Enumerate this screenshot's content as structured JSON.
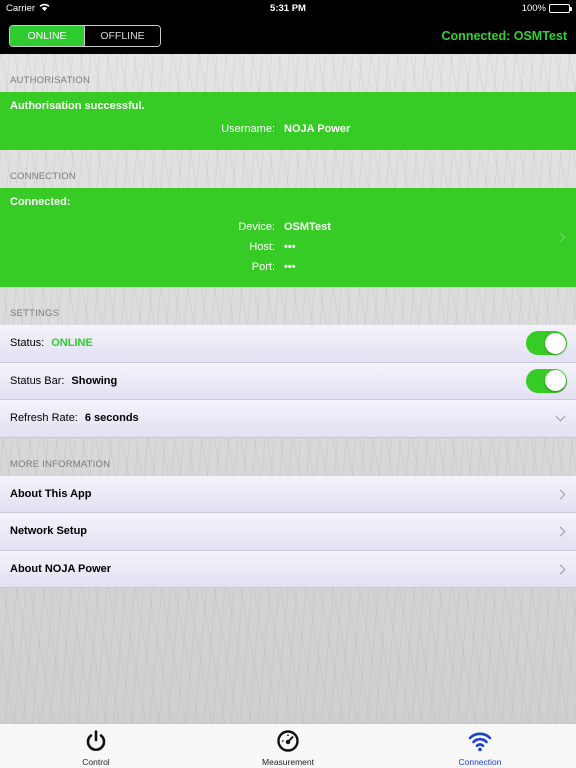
{
  "status_bar": {
    "carrier": "Carrier",
    "time": "5:31 PM",
    "battery": "100%"
  },
  "nav": {
    "segments": [
      "ONLINE",
      "OFFLINE"
    ],
    "selected_segment": "ONLINE",
    "title": "Connected: OSMTest"
  },
  "sections": {
    "authorisation": {
      "header": "AUTHORISATION",
      "message": "Authorisation successful.",
      "username_label": "Username:",
      "username_value": "NOJA Power"
    },
    "connection": {
      "header": "CONNECTION",
      "message": "Connected:",
      "device_label": "Device:",
      "device_value": "OSMTest",
      "host_label": "Host:",
      "host_value": "•••",
      "port_label": "Port:",
      "port_value": "•••"
    },
    "settings": {
      "header": "SETTINGS",
      "status_label": "Status:",
      "status_value": "ONLINE",
      "status_toggle_on": true,
      "statusbar_label": "Status Bar:",
      "statusbar_value": "Showing",
      "statusbar_toggle_on": true,
      "refresh_label": "Refresh Rate:",
      "refresh_value": "6 seconds"
    },
    "more_info": {
      "header": "MORE INFORMATION",
      "items": [
        "About This App",
        "Network Setup",
        "About NOJA Power"
      ]
    }
  },
  "tabs": [
    {
      "label": "Control",
      "icon": "power-icon"
    },
    {
      "label": "Measurement",
      "icon": "gauge-icon"
    },
    {
      "label": "Connection",
      "icon": "wifi-icon"
    }
  ],
  "active_tab": "Connection",
  "colors": {
    "accent_green": "#37cb25",
    "active_tab_blue": "#1a3fd6"
  }
}
